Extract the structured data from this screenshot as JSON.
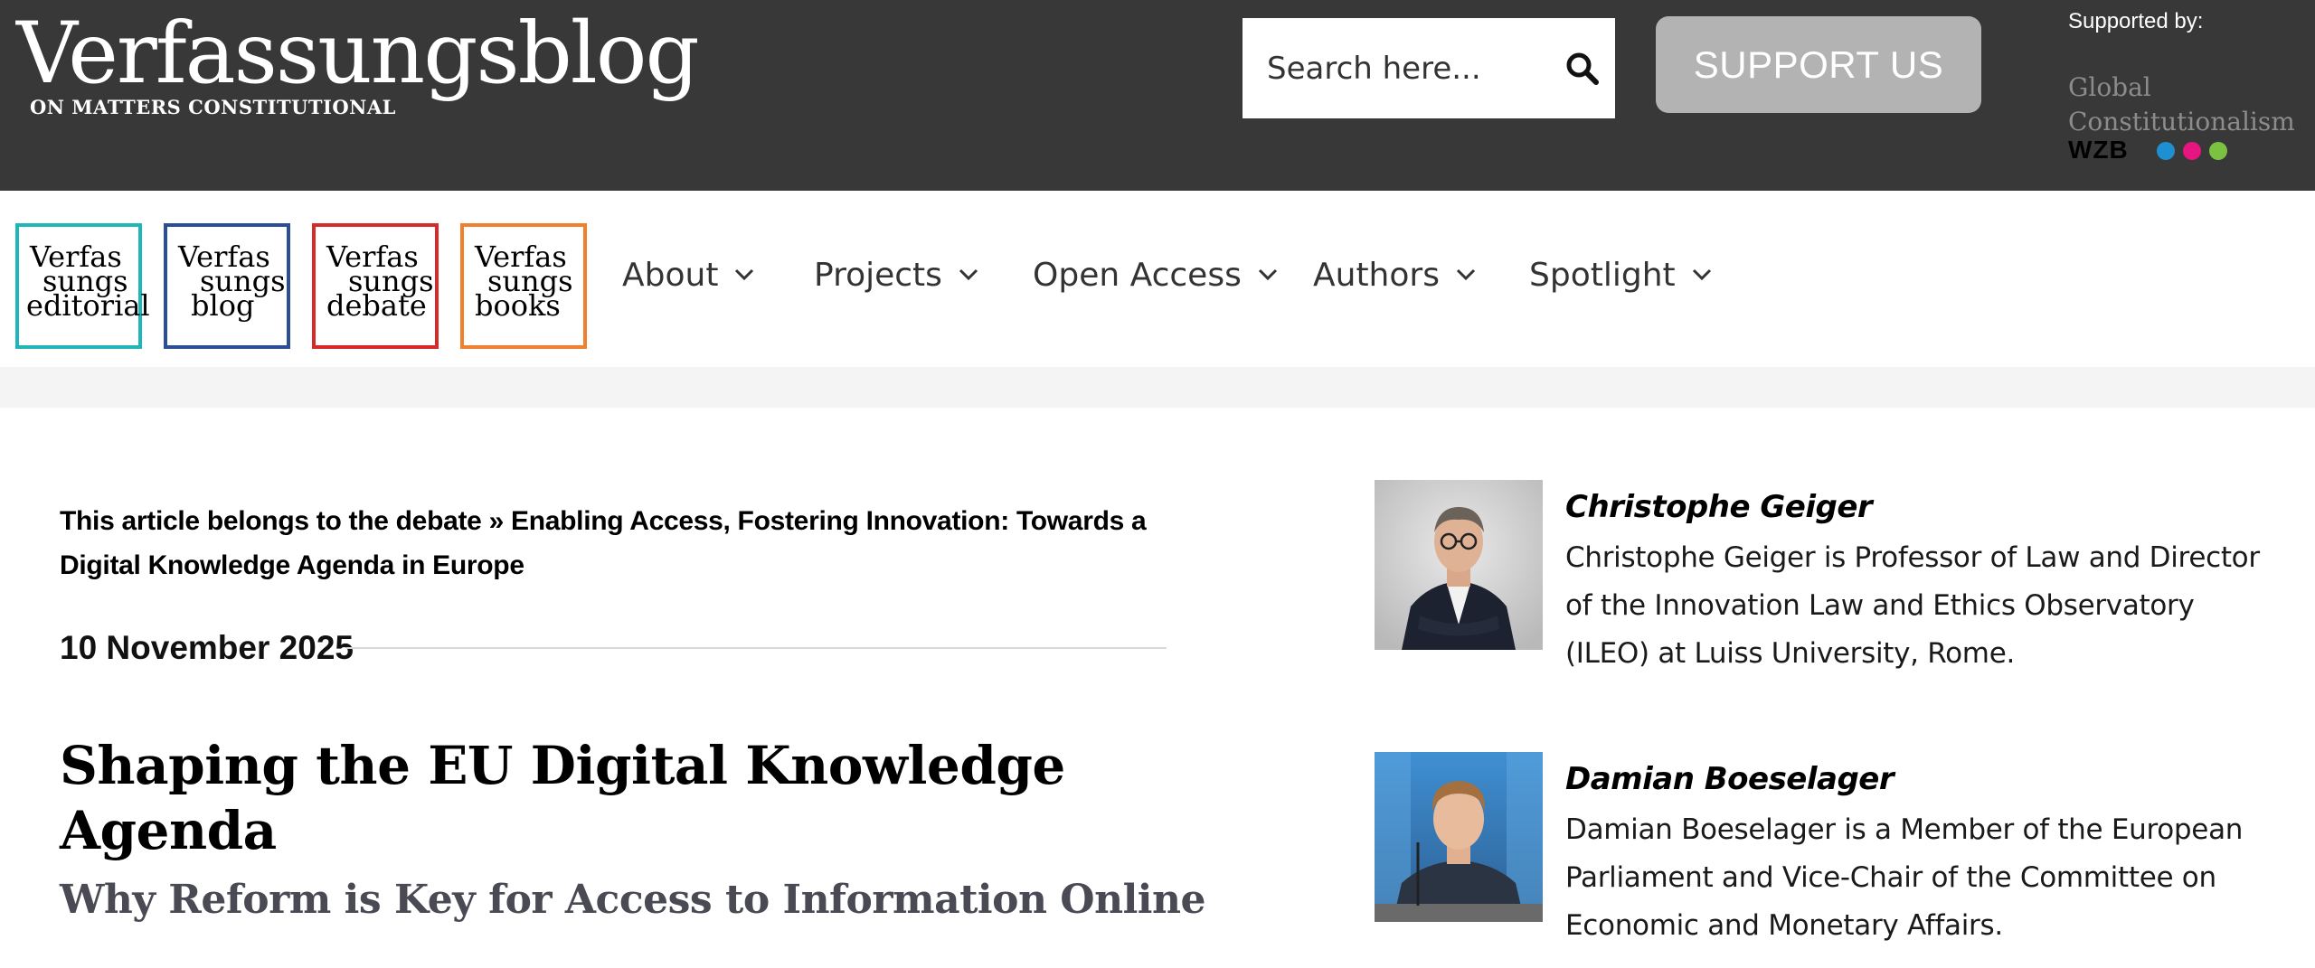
{
  "header": {
    "site_title": "Verfassungsblog",
    "tagline": "ON MATTERS CONSTITUTIONAL",
    "search_placeholder": "Search here...",
    "support_label": "SUPPORT US",
    "supported_by_label": "Supported by:",
    "sponsor_logo_line1": "Global",
    "sponsor_logo_line2": "Constitutionalism",
    "sponsor2_logo": "WZB",
    "dot_colors": [
      "#1e8fd0",
      "#e6157f",
      "#7cc242"
    ]
  },
  "nav": {
    "logos": [
      {
        "lines": [
          "Verfas",
          "sungs",
          "editorial"
        ],
        "color": "#1fb6ba"
      },
      {
        "lines": [
          "Verfas",
          "sungs",
          "blog"
        ],
        "color": "#2a4f96"
      },
      {
        "lines": [
          "Verfas",
          "sungs",
          "debate"
        ],
        "color": "#d62a2a"
      },
      {
        "lines": [
          "Verfas",
          "sungs",
          "books"
        ],
        "color": "#f07f2e"
      }
    ],
    "items": [
      {
        "label": "About"
      },
      {
        "label": "Projects"
      },
      {
        "label": "Open Access"
      },
      {
        "label": "Authors"
      },
      {
        "label": "Spotlight"
      }
    ]
  },
  "article": {
    "debate_prefix": "This article belongs to the debate » ",
    "debate_title": "Enabling Access, Fostering Innovation: Towards a Digital Knowledge Agenda in Europe",
    "date": "10 November 2025",
    "title": "Shaping the EU Digital Knowledge Agenda",
    "subtitle": "Why Reform is Key for Access to Information Online"
  },
  "authors": [
    {
      "name": "Christophe Geiger",
      "bio": "Christophe Geiger is Professor of Law and Director of the Innovation Law and Ethics Observatory (ILEO) at Luiss University, Rome."
    },
    {
      "name": "Damian Boeselager",
      "bio": "Damian Boeselager is a Member of the European Parliament and Vice-Chair of the Committee on Economic and Monetary Affairs."
    }
  ]
}
